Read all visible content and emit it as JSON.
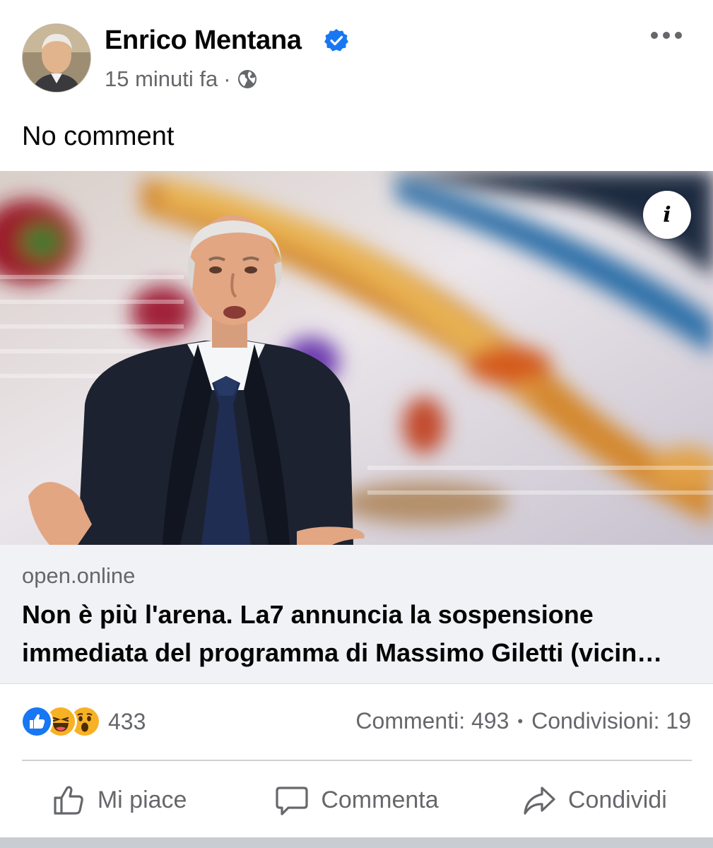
{
  "post": {
    "author": "Enrico Mentana",
    "verified_icon": "verified-badge-icon",
    "time": "15 minuti fa",
    "separator": "·",
    "audience_icon": "globe-icon",
    "more_icon": "more-options-icon",
    "caption": "No comment"
  },
  "link": {
    "image_alt": "Massimo Giletti on stage with open hands",
    "info_label": "i",
    "domain": "open.online",
    "headline": "Non è più l'arena. La7 annuncia la sospensione immediata del programma di Massimo Giletti (vicin…"
  },
  "engagement": {
    "reaction_icons": [
      "like-reaction-icon",
      "haha-reaction-icon",
      "wow-reaction-icon"
    ],
    "reaction_count": "433",
    "comments": "Commenti: 493",
    "dot": "•",
    "shares": "Condivisioni: 19"
  },
  "actions": {
    "like": "Mi piace",
    "comment": "Commenta",
    "share": "Condividi"
  },
  "colors": {
    "accent": "#1877f2",
    "secondary_text": "#65676b",
    "card_bg": "#f0f2f5"
  }
}
